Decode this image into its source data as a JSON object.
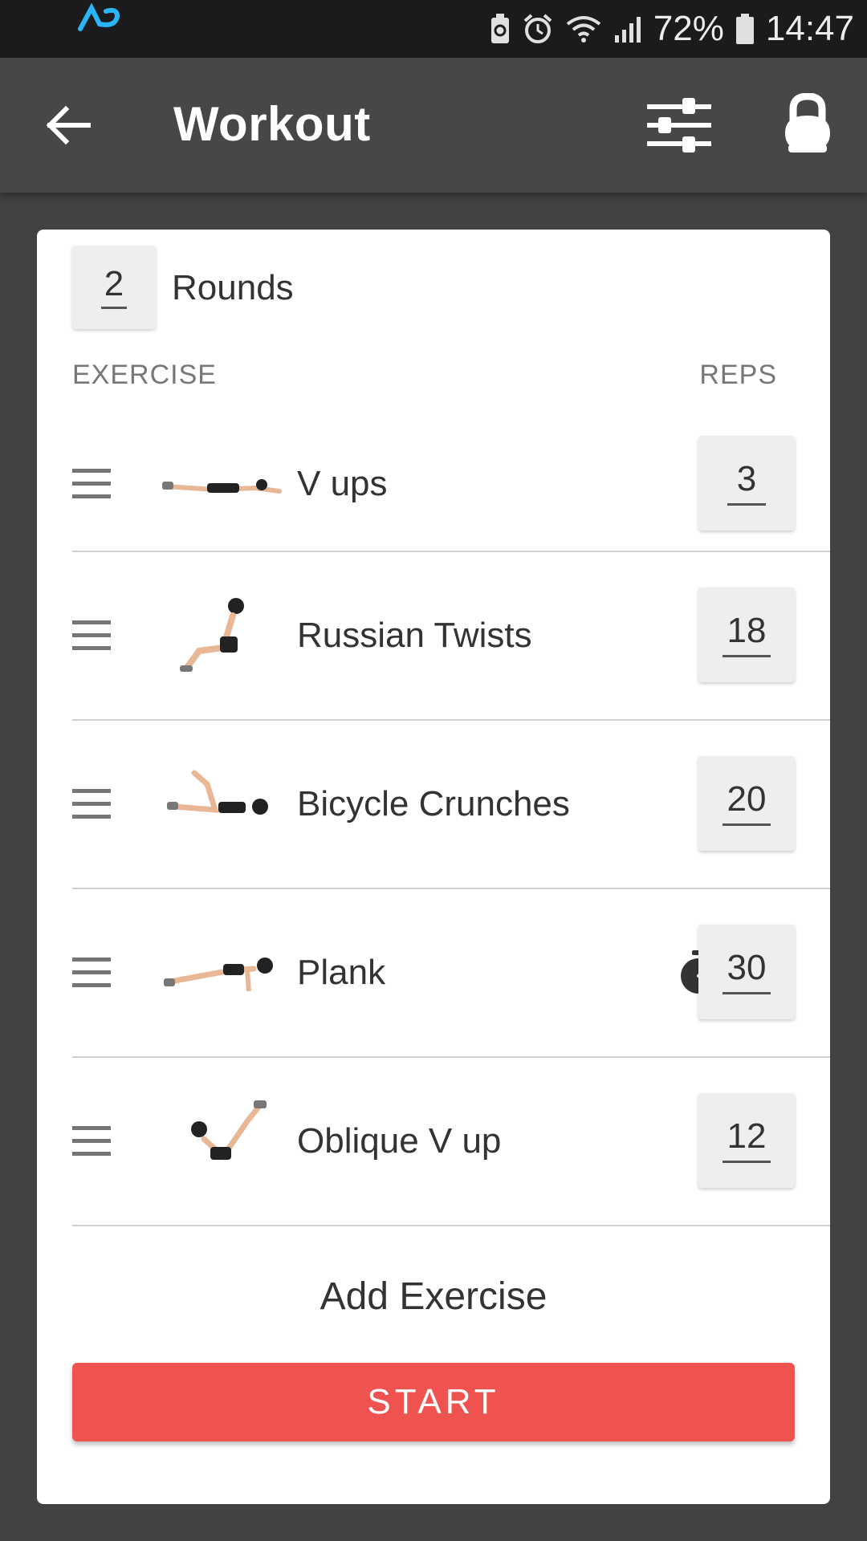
{
  "status_bar": {
    "battery": "72%",
    "time": "14:47"
  },
  "app_bar": {
    "title": "Workout"
  },
  "rounds": {
    "value": "2",
    "label": "Rounds"
  },
  "headers": {
    "exercise": "EXERCISE",
    "reps": "REPS"
  },
  "exercises": [
    {
      "name": "V ups",
      "reps": "3",
      "timed": false
    },
    {
      "name": "Russian Twists",
      "reps": "18",
      "timed": false
    },
    {
      "name": "Bicycle Crunches",
      "reps": "20",
      "timed": false
    },
    {
      "name": "Plank",
      "reps": "30",
      "timed": true
    },
    {
      "name": "Oblique V up",
      "reps": "12",
      "timed": false
    }
  ],
  "add_exercise_label": "Add Exercise",
  "start_label": "START",
  "colors": {
    "accent": "#ef5350",
    "app_bar": "#474747",
    "background": "#424242"
  }
}
